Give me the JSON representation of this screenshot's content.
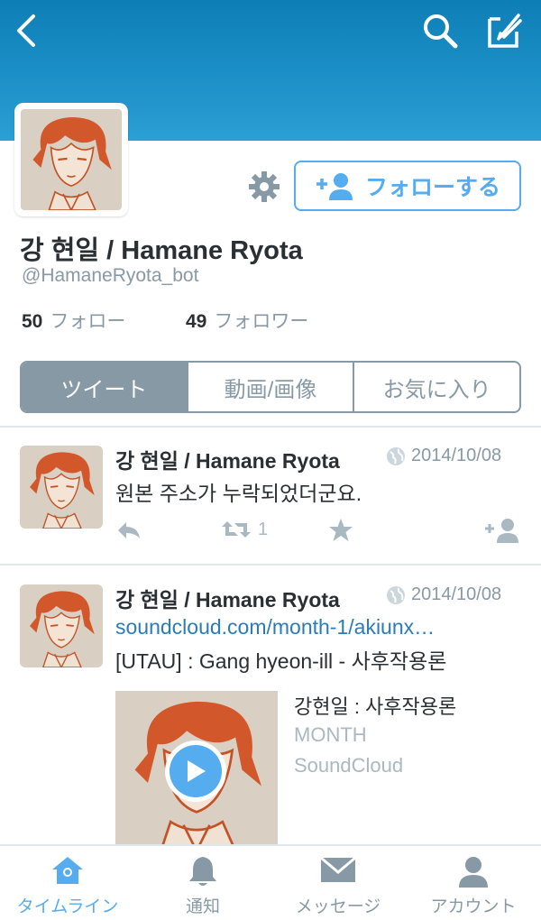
{
  "header": {
    "back_icon": "chevron-left-icon",
    "search_icon": "search-icon",
    "compose_icon": "compose-icon"
  },
  "profile": {
    "name": "강 현일 / Hamane Ryota",
    "handle": "@HamaneRyota_bot",
    "following_count": "50",
    "following_label": "フォロー",
    "followers_count": "49",
    "followers_label": "フォロワー",
    "follow_button": "フォローする"
  },
  "segments": [
    {
      "label": "ツイート",
      "selected": true
    },
    {
      "label": "動画/画像",
      "selected": false
    },
    {
      "label": "お気に入り",
      "selected": false
    }
  ],
  "tweets": [
    {
      "author": "강 현일 / Hamane Ryota",
      "date": "2014/10/08",
      "text": "원본 주소가 누락되었더군요.",
      "retweet_count": "1"
    },
    {
      "author": "강 현일 / Hamane Ryota",
      "date": "2014/10/08",
      "link": "soundcloud.com/month-1/akiunx…",
      "text": "[UTAU] : Gang hyeon-ill - 사후작용론",
      "card": {
        "title": "강현일 : 사후작용론",
        "subtitle": "MONTH",
        "source": "SoundCloud"
      }
    }
  ],
  "tabbar": [
    {
      "label": "タイムライン",
      "icon": "home-icon",
      "active": true
    },
    {
      "label": "通知",
      "icon": "bell-icon",
      "active": false
    },
    {
      "label": "メッセージ",
      "icon": "envelope-icon",
      "active": false
    },
    {
      "label": "アカウント",
      "icon": "person-icon",
      "active": false
    }
  ],
  "colors": {
    "header": "#1a8ec6",
    "accent": "#55acee",
    "link": "#2b7bb9",
    "muted": "#8899a6"
  }
}
